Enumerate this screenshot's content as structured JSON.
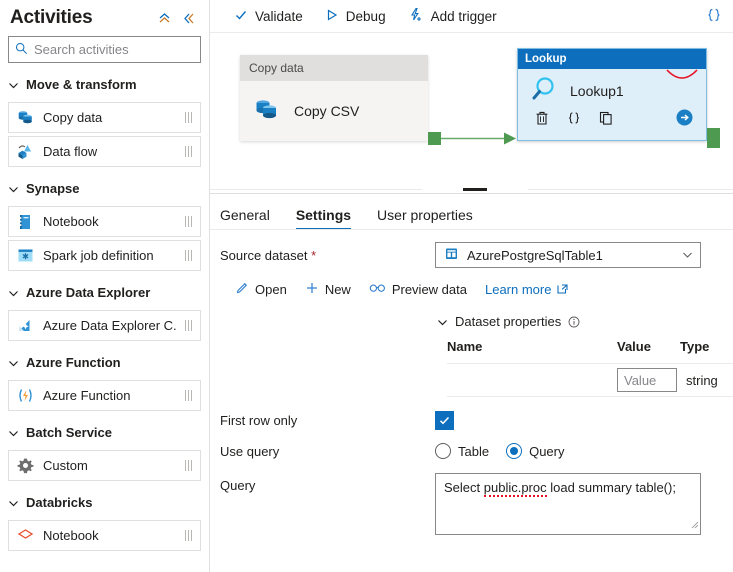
{
  "sidebar": {
    "title": "Activities",
    "collapse_up_icon": "chevron-double-up-icon",
    "collapse_left_icon": "chevron-double-left-icon",
    "search": {
      "placeholder": "Search activities",
      "value": "",
      "icon": "search-icon"
    },
    "groups": [
      {
        "label": "Move & transform",
        "items": [
          {
            "label": "Copy data",
            "icon": "copy-data-icon"
          },
          {
            "label": "Data flow",
            "icon": "data-flow-icon"
          }
        ]
      },
      {
        "label": "Synapse",
        "items": [
          {
            "label": "Notebook",
            "icon": "notebook-icon"
          },
          {
            "label": "Spark job definition",
            "icon": "spark-job-icon"
          }
        ]
      },
      {
        "label": "Azure Data Explorer",
        "items": [
          {
            "label": "Azure Data Explorer C...",
            "icon": "azure-data-explorer-icon"
          }
        ]
      },
      {
        "label": "Azure Function",
        "items": [
          {
            "label": "Azure Function",
            "icon": "azure-function-icon"
          }
        ]
      },
      {
        "label": "Batch Service",
        "items": [
          {
            "label": "Custom",
            "icon": "gear-icon"
          }
        ]
      },
      {
        "label": "Databricks",
        "items": [
          {
            "label": "Notebook",
            "icon": "databricks-notebook-icon"
          }
        ]
      }
    ]
  },
  "toolbar": {
    "validate_label": "Validate",
    "debug_label": "Debug",
    "add_trigger_label": "Add trigger",
    "code_icon": "code-braces-icon"
  },
  "canvas": {
    "copy_node": {
      "type_label": "Copy data",
      "name": "Copy CSV",
      "icon": "copy-data-icon"
    },
    "lookup_node": {
      "type_label": "Lookup",
      "name": "Lookup1",
      "icon": "magnifier-icon",
      "actions": [
        {
          "name": "delete-icon",
          "glyph": "trash"
        },
        {
          "name": "code-braces-icon",
          "glyph": "braces"
        },
        {
          "name": "clone-icon",
          "glyph": "copy"
        },
        {
          "name": "run-arrow-icon",
          "glyph": "arrow"
        }
      ]
    }
  },
  "properties": {
    "tabs": [
      {
        "label": "General",
        "active": false
      },
      {
        "label": "Settings",
        "active": true
      },
      {
        "label": "User properties",
        "active": false
      }
    ],
    "source_dataset": {
      "label": "Source dataset",
      "required_mark": "*",
      "value": "AzurePostgreSqlTable1",
      "icon": "dataset-table-icon",
      "chevron": "chevron-down-icon"
    },
    "links": [
      {
        "label": "Open",
        "icon": "pencil-icon"
      },
      {
        "label": "New",
        "icon": "plus-icon"
      },
      {
        "label": "Preview data",
        "icon": "glasses-icon"
      },
      {
        "label": "Learn more",
        "icon": "external-link-icon"
      }
    ],
    "dataset_properties": {
      "title": "Dataset properties",
      "info_icon": "info-icon",
      "chevron": "chevron-down-icon",
      "columns": [
        "Name",
        "Value",
        "Type"
      ],
      "rows": [
        {
          "name": "",
          "value_placeholder": "Value",
          "type": "string"
        }
      ]
    },
    "first_row_only": {
      "label": "First row only",
      "checked": true,
      "check_icon": "checkmark-icon"
    },
    "use_query": {
      "label": "Use query",
      "options": [
        {
          "label": "Table",
          "selected": false
        },
        {
          "label": "Query",
          "selected": true
        }
      ]
    },
    "query": {
      "label": "Query",
      "value_part1": "Select ",
      "value_misspelled": "public.proc",
      "value_part2": " load summary table();"
    }
  },
  "colors": {
    "accent": "#0c6ebd",
    "node_header": "#0c6ebd",
    "node_body": "#deeffa",
    "connector_green": "#4e9a51",
    "error_red": "#e81123",
    "required_red": "#a4262c"
  }
}
